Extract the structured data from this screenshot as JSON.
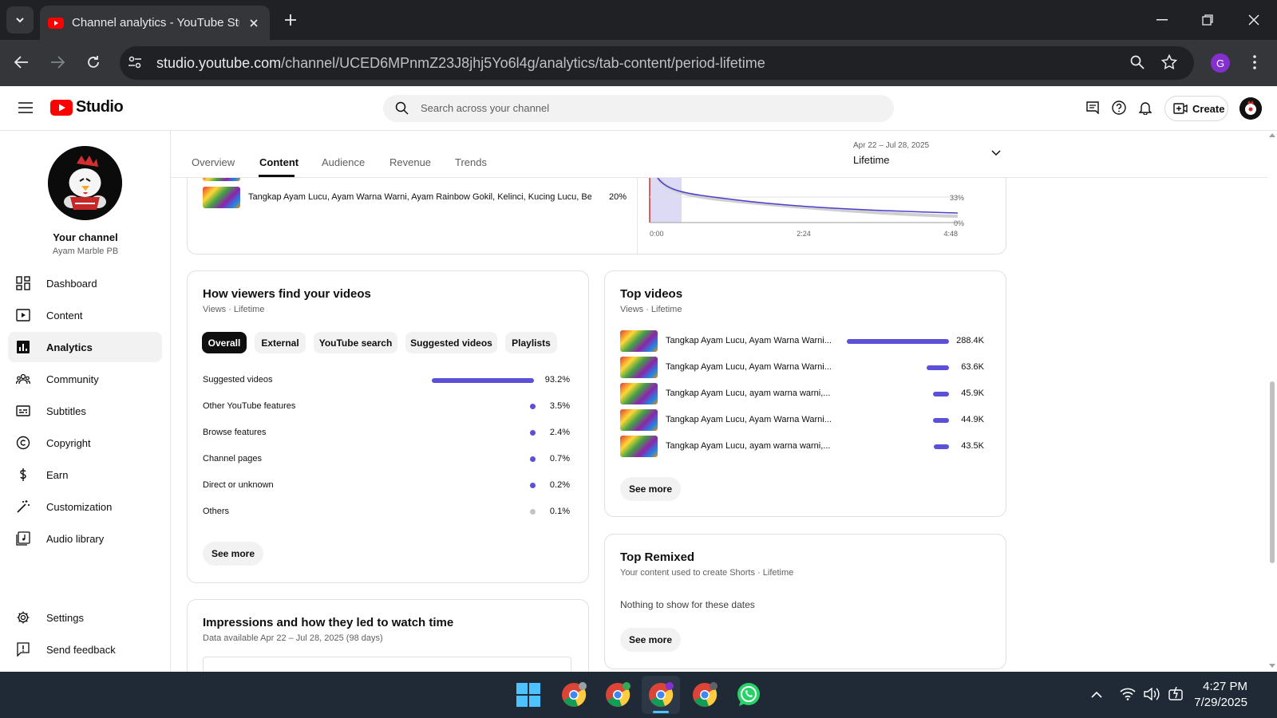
{
  "browser": {
    "tab_title": "Channel analytics - YouTube Studio",
    "url_host": "studio.youtube.com",
    "url_path": "/channel/UCED6MPnmZ23J8jhj5Yo6l4g/analytics/tab-content/period-lifetime",
    "profile_initial": "G"
  },
  "header": {
    "logo_text": "Studio",
    "search_placeholder": "Search across your channel",
    "create_label": "Create"
  },
  "sidebar": {
    "channel_label": "Your channel",
    "channel_name": "Ayam Marble PB",
    "items": [
      {
        "label": "Dashboard",
        "icon": "dashboard-icon"
      },
      {
        "label": "Content",
        "icon": "content-icon"
      },
      {
        "label": "Analytics",
        "icon": "analytics-icon",
        "active": true
      },
      {
        "label": "Community",
        "icon": "community-icon"
      },
      {
        "label": "Subtitles",
        "icon": "subtitles-icon"
      },
      {
        "label": "Copyright",
        "icon": "copyright-icon"
      },
      {
        "label": "Earn",
        "icon": "dollar-icon"
      },
      {
        "label": "Customization",
        "icon": "magic-wand-icon"
      },
      {
        "label": "Audio library",
        "icon": "audio-library-icon"
      }
    ],
    "bottom_items": [
      {
        "label": "Settings",
        "icon": "gear-icon"
      },
      {
        "label": "Send feedback",
        "icon": "feedback-icon"
      }
    ]
  },
  "analytics_tabs": [
    "Overview",
    "Content",
    "Audience",
    "Revenue",
    "Trends"
  ],
  "active_tab": "Content",
  "period": {
    "range": "Apr 22 – Jul 28, 2025",
    "label": "Lifetime"
  },
  "top_partial": {
    "video_title": "Tangkap Ayam Lucu, Ayam Warna Warni, Ayam Rainbow Gokil, Kelinci, Kucing Lucu, Beb...",
    "video_value": "20%",
    "chart_y_ticks": [
      "33%",
      "0%"
    ],
    "chart_x_ticks": [
      "0:00",
      "2:24",
      "4:48"
    ]
  },
  "traffic_sources": {
    "title": "How viewers find your videos",
    "subtitle": "Views · Lifetime",
    "chips": [
      "Overall",
      "External",
      "YouTube search",
      "Suggested videos",
      "Playlists"
    ],
    "selected_chip": "Overall",
    "rows": [
      {
        "label": "Suggested videos",
        "value": "93.2%",
        "share": 0.932
      },
      {
        "label": "Other YouTube features",
        "value": "3.5%",
        "share": 0.035
      },
      {
        "label": "Browse features",
        "value": "2.4%",
        "share": 0.024
      },
      {
        "label": "Channel pages",
        "value": "0.7%",
        "share": 0.007
      },
      {
        "label": "Direct or unknown",
        "value": "0.2%",
        "share": 0.002
      },
      {
        "label": "Others",
        "value": "0.1%",
        "share": 0.001
      }
    ],
    "see_more": "See more"
  },
  "top_videos": {
    "title": "Top videos",
    "subtitle": "Views · Lifetime",
    "rows": [
      {
        "title": "Tangkap Ayam Lucu, Ayam Warna Warni...",
        "value": "288.4K",
        "views": 288.4
      },
      {
        "title": "Tangkap Ayam Lucu, Ayam Warna Warni...",
        "value": "63.6K",
        "views": 63.6
      },
      {
        "title": "Tangkap Ayam Lucu, ayam warna warni,...",
        "value": "45.9K",
        "views": 45.9
      },
      {
        "title": "Tangkap Ayam Lucu, Ayam Warna Warni...",
        "value": "44.9K",
        "views": 44.9
      },
      {
        "title": "Tangkap Ayam Lucu, ayam warna warni,...",
        "value": "43.5K",
        "views": 43.5
      }
    ],
    "see_more": "See more"
  },
  "top_remixed": {
    "title": "Top Remixed",
    "subtitle": "Your content used to create Shorts · Lifetime",
    "empty_text": "Nothing to show for these dates",
    "see_more": "See more"
  },
  "impressions": {
    "title": "Impressions and how they led to watch time",
    "subtitle": "Data available Apr 22 – Jul 28, 2025 (98 days)"
  },
  "taskbar": {
    "time": "4:27 PM",
    "date": "7/29/2025"
  },
  "colors": {
    "accent": "#5b50d6",
    "yt_red": "#ff0000",
    "chrome_dark": "#202124"
  }
}
